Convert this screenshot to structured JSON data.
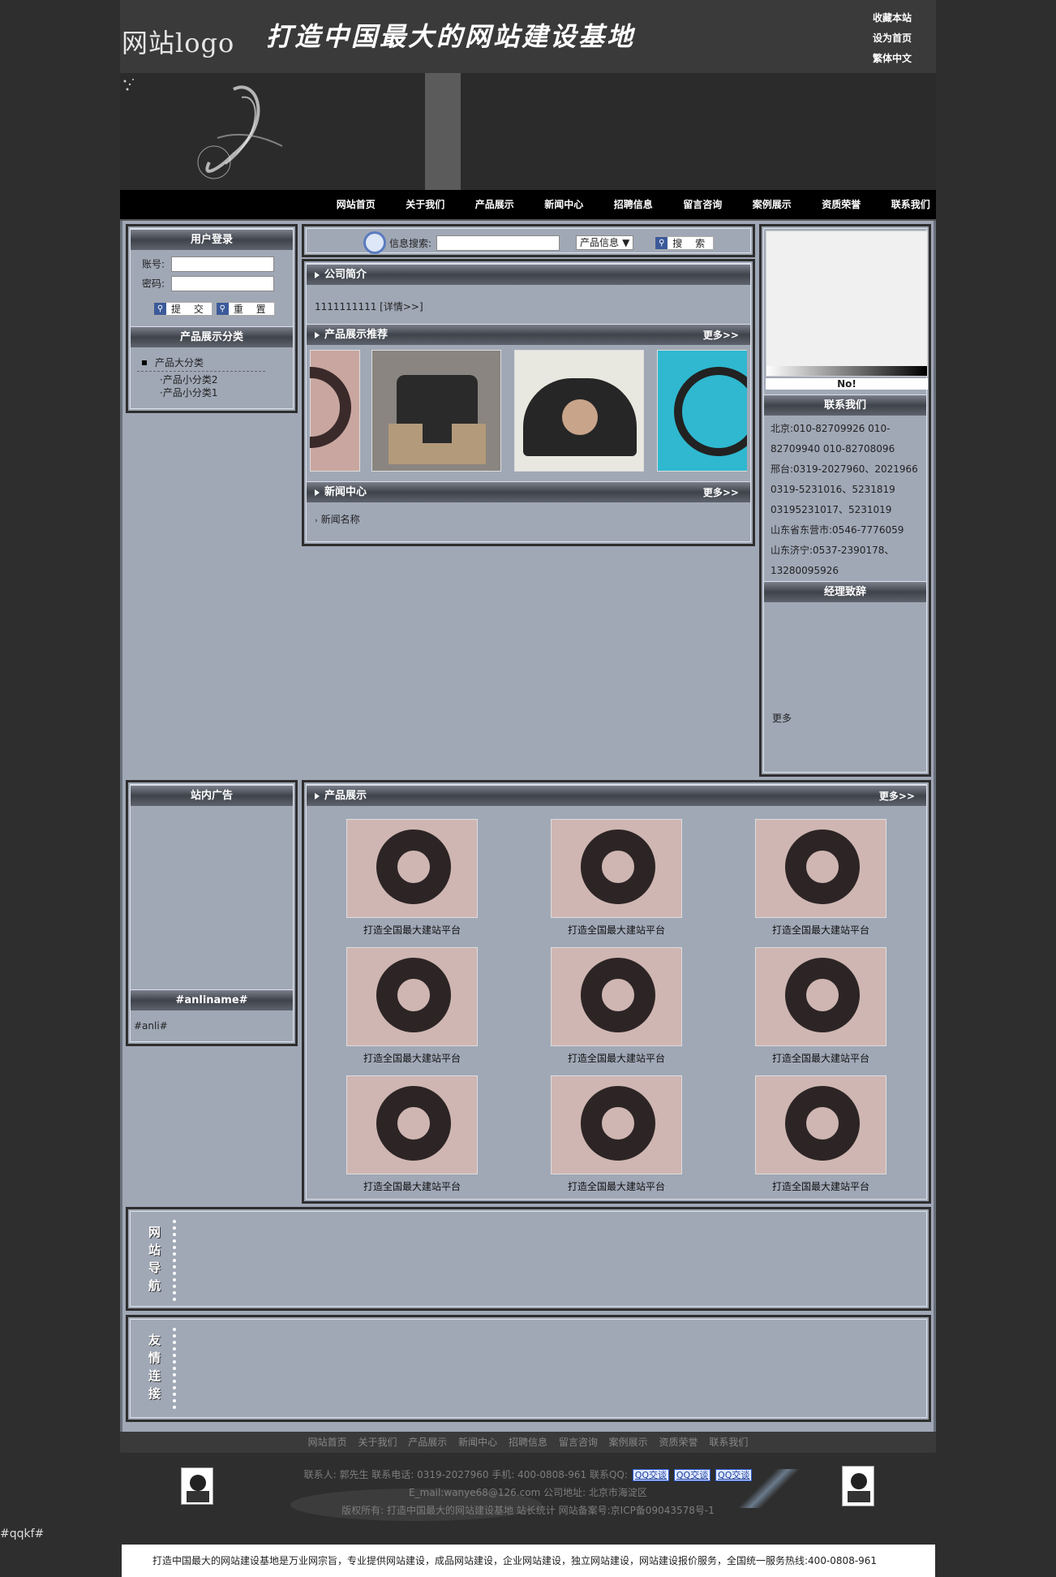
{
  "header": {
    "logo": "网站logo",
    "slogan": "打造中国最大的网站建设基地",
    "top_links": [
      "收藏本站",
      "设为首页",
      "繁体中文"
    ]
  },
  "nav": [
    "网站首页",
    "关于我们",
    "产品展示",
    "新闻中心",
    "招聘信息",
    "留言咨询",
    "案例展示",
    "资质荣誉",
    "联系我们"
  ],
  "login": {
    "title": "用户登录",
    "account_label": "账号:",
    "password_label": "密码:",
    "submit": "提 交",
    "reset": "重 置"
  },
  "category": {
    "title": "产品展示分类",
    "main": "产品大分类",
    "subs": [
      "·产品小分类2",
      "·产品小分类1"
    ]
  },
  "search": {
    "label": "信息搜索:",
    "select_value": "产品信息",
    "button": "搜 索"
  },
  "intro": {
    "title": "公司简介",
    "text": "1111111111 [详情>>]"
  },
  "recommend": {
    "title": "产品展示推荐",
    "more": "更多>>"
  },
  "news": {
    "title": "新闻中心",
    "more": "更多>>",
    "items": [
      "新闻名称"
    ]
  },
  "right": {
    "flash_label": "No!",
    "contact_title": "联系我们",
    "contact_lines": [
      "北京:010-82709926 010-",
      "82709940 010-82708096",
      "邢台:0319-2027960、2021966",
      "0319-5231016、5231819",
      "03195231017、5231019",
      "山东省东营市:0546-7776059",
      "山东济宁:0537-2390178、",
      "13280095926"
    ],
    "manager_title": "经理致辞",
    "manager_more": "更多"
  },
  "ads": {
    "title": "站内广告",
    "anli_title": "#anliname#",
    "anli_text": "#anli#"
  },
  "products": {
    "title": "产品展示",
    "more": "更多>>",
    "items": [
      "打造全国最大建站平台",
      "打造全国最大建站平台",
      "打造全国最大建站平台",
      "打造全国最大建站平台",
      "打造全国最大建站平台",
      "打造全国最大建站平台",
      "打造全国最大建站平台",
      "打造全国最大建站平台",
      "打造全国最大建站平台"
    ]
  },
  "sitenav": {
    "title": "网站导航"
  },
  "friends": {
    "title": "友情连接"
  },
  "footer": {
    "links": [
      "网站首页",
      "关于我们",
      "产品展示",
      "新闻中心",
      "招聘信息",
      "留言咨询",
      "案例展示",
      "资质荣誉",
      "联系我们"
    ],
    "line1": "联系人: 郭先生  联系电话: 0319-2027960  手机: 400-0808-961  联系QQ:",
    "qq": [
      "QQ交谈",
      "QQ交谈",
      "QQ交谈"
    ],
    "line2": "E_mail:wanye68@126.com  公司地址: 北京市海淀区",
    "line3": "版权所有: 打造中国最大的网站建设基地    站长统计    网站备案号:京ICP备09043578号-1"
  },
  "qqkf": "#qqkf#",
  "bottom_bar": "打造中国最大的网站建设基地是万业网宗旨，专业提供网站建设，成品网站建设，企业网站建设，独立网站建设，网站建设报价服务，全国统一服务热线:400-0808-961"
}
